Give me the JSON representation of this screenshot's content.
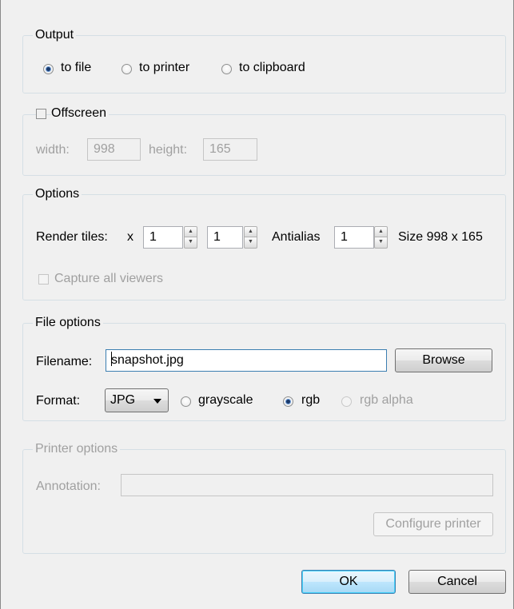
{
  "output": {
    "title": "Output",
    "options": [
      "to file",
      "to printer",
      "to clipboard"
    ],
    "selected": "to file"
  },
  "offscreen": {
    "label": "Offscreen",
    "checked": false,
    "width_label": "width:",
    "width_value": "998",
    "height_label": "height:",
    "height_value": "165"
  },
  "options": {
    "title": "Options",
    "render_tiles_label": "Render tiles:",
    "x_label": "x",
    "tiles_x": "1",
    "tiles_y": "1",
    "antialias_label": "Antialias",
    "antialias_value": "1",
    "size_label": "Size 998 x 165",
    "capture_all_label": "Capture all viewers"
  },
  "file_options": {
    "title": "File options",
    "filename_label": "Filename:",
    "filename_value": "snapshot.jpg",
    "browse_label": "Browse",
    "format_label": "Format:",
    "format_value": "JPG",
    "color_modes": [
      "grayscale",
      "rgb",
      "rgb alpha"
    ],
    "selected_mode": "rgb"
  },
  "printer_options": {
    "title": "Printer options",
    "annotation_label": "Annotation:",
    "annotation_value": "",
    "configure_label": "Configure printer"
  },
  "footer": {
    "ok_label": "OK",
    "cancel_label": "Cancel"
  }
}
